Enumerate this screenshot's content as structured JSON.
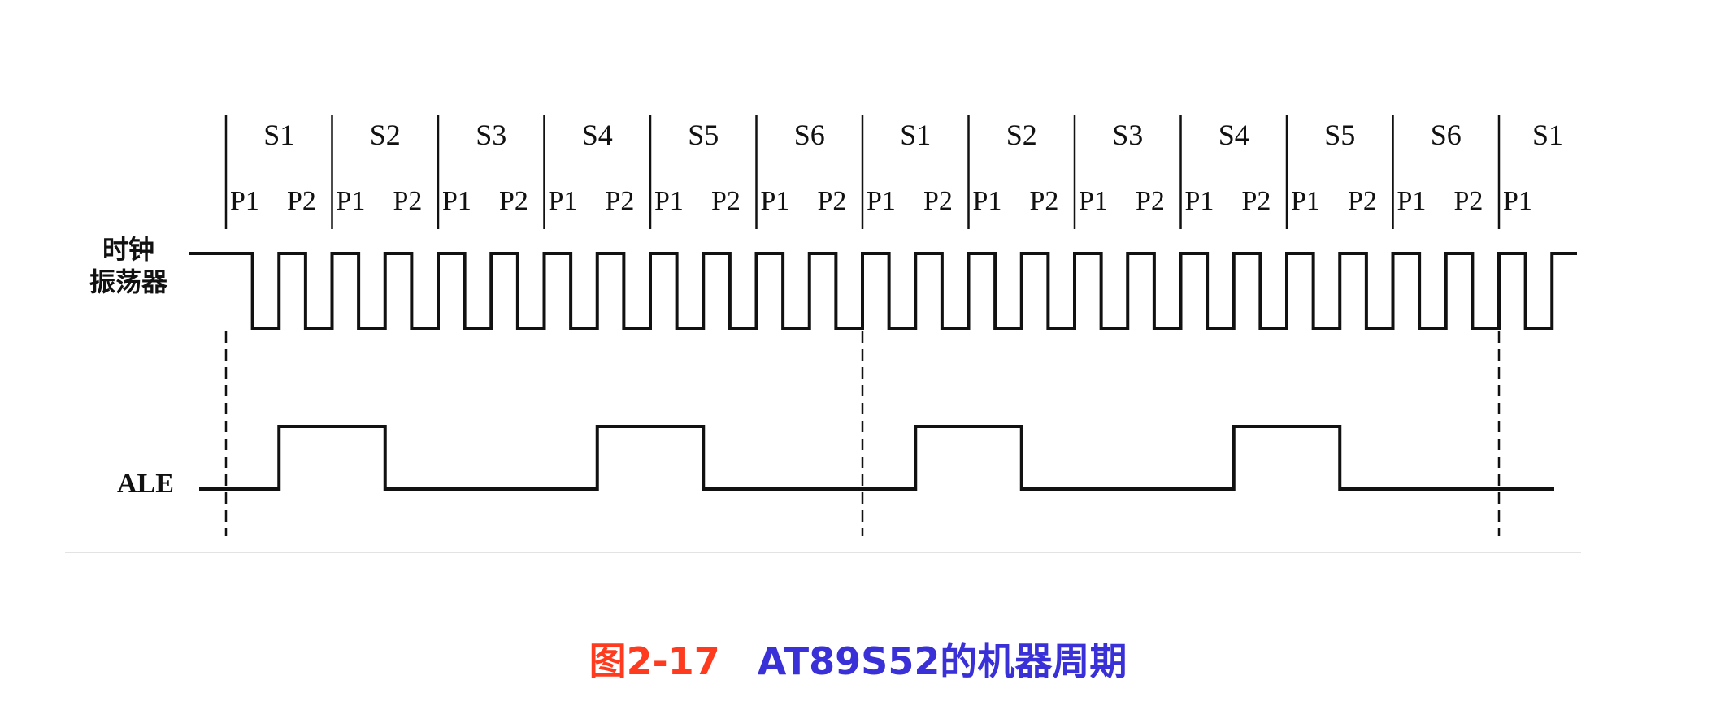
{
  "diagram": {
    "state_labels": [
      "S1",
      "S2",
      "S3",
      "S4",
      "S5",
      "S6",
      "S1",
      "S2",
      "S3",
      "S4",
      "S5",
      "S6",
      "S1"
    ],
    "phase_labels": [
      "P1",
      "P2"
    ],
    "signals": {
      "clock": {
        "label_line1": "时钟",
        "label_line2": "振荡器"
      },
      "ale": {
        "label": "ALE",
        "pulses_per_machine_cycle": 2
      }
    },
    "caption": {
      "figure_number": "图2-17",
      "title": "AT89S52的机器周期"
    }
  }
}
